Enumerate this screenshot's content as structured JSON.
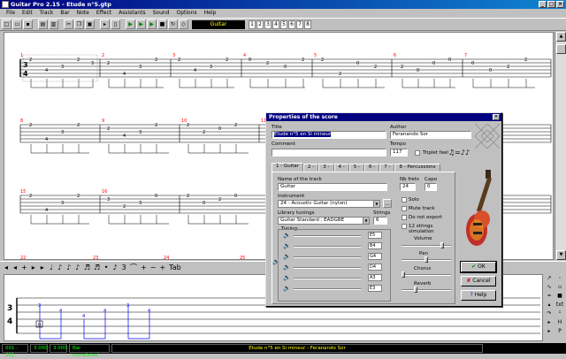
{
  "window": {
    "title": "Guitar Pro 2.15 - Etude n°5.gtp"
  },
  "menu": [
    "File",
    "Edit",
    "Track",
    "Bar",
    "Note",
    "Effect",
    "Assistants",
    "Sound",
    "Options",
    "Help"
  ],
  "toolbar": {
    "track_name": "Guitar",
    "numbers": [
      "1",
      "2",
      "3",
      "4",
      "5",
      "6",
      "7",
      "8"
    ]
  },
  "score": {
    "time_signature": {
      "top": "3",
      "bottom": "4"
    },
    "system1_measures": [
      "1",
      "2",
      "3",
      "4",
      "5",
      "6",
      "7"
    ],
    "system2_labels": [
      "8",
      "9",
      "10",
      "11"
    ],
    "system3_labels": [
      "15",
      "16"
    ],
    "system4_labels": [
      "22",
      "23",
      "24",
      "25"
    ]
  },
  "symbols": [
    "◂",
    "◂",
    "+",
    "▸",
    "▸",
    "♩",
    "♪",
    "♪",
    "♪",
    "♬",
    "♬",
    "•",
    "♪",
    "3",
    "⌒",
    "+",
    "−",
    "+",
    "Tab"
  ],
  "lower": {
    "time_signature": {
      "top": "3",
      "bottom": "4"
    },
    "note": "0"
  },
  "status": {
    "bar": "001 : 001",
    "time1": "3.000",
    "time2": "3.000",
    "state": "Bar completed",
    "song": "Etude n°5 en Si mineur - Feranando Sor"
  },
  "dialog": {
    "title": "Properties of the score",
    "title_label": "Title",
    "title_value": "Etude n°5 en Si mineur",
    "author_label": "Author",
    "author_value": "Feranando Sor",
    "comment_label": "Comment",
    "tempo_label": "Tempo",
    "tempo_value": "117",
    "triplet_label": "Triplet feel",
    "tabs": [
      "1 - Guitar",
      "2 -",
      "3 -",
      "4 -",
      "5 -",
      "6 -",
      "7 -",
      "8 - Percussions"
    ],
    "name_label": "Name of the track",
    "name_value": "Guitar",
    "frets_label": "Nb frets",
    "frets_value": "24",
    "capo_label": "Capo",
    "capo_value": "0",
    "instrument_label": "Instrument",
    "instrument_value": "24 - Acoustic Guitar (nylon)",
    "library_label": "Library tunings",
    "library_value": "Guitar Standard : EADGBE",
    "strings_label": "Strings",
    "strings_value": "6",
    "tuning_label": "Tuning",
    "tuning": [
      "E5",
      "B4",
      "G4",
      "D4",
      "A3",
      "E3"
    ],
    "options": [
      "Solo",
      "Mute track",
      "Do not export",
      "12 strings simulation"
    ],
    "volume_label": "Volume",
    "pan_label": "Pan",
    "chorus_label": "Chorus",
    "reverb_label": "Reverb",
    "ok_label": "OK",
    "cancel_label": "Cancel",
    "help_label": "Help"
  },
  "colors": {
    "titlebar": "#000080",
    "status_text": "#00ff00",
    "measure_number": "#ff0000",
    "note_blue": "#0000ff"
  }
}
